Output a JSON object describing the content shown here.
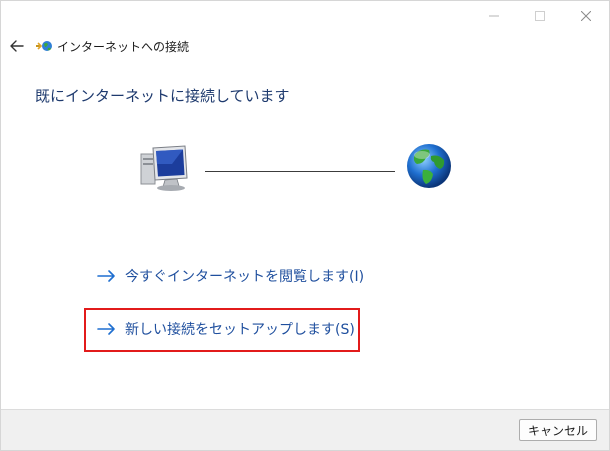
{
  "window": {
    "nav_title": "インターネットへの接続"
  },
  "heading": "既にインターネットに接続しています",
  "tasks": [
    {
      "label": "今すぐインターネットを閲覧します(I)"
    },
    {
      "label": "新しい接続をセットアップします(S)"
    }
  ],
  "footer": {
    "cancel_label": "キャンセル"
  },
  "icons": {
    "back": "back-arrow-icon",
    "app": "network-connection-icon",
    "computer": "computer-icon",
    "globe": "globe-icon",
    "link_arrow": "arrow-right-icon"
  },
  "colors": {
    "heading": "#1e3a6e",
    "link": "#1f4f9e",
    "highlight": "#e21b1b",
    "footer_bg": "#f0f0f0"
  }
}
